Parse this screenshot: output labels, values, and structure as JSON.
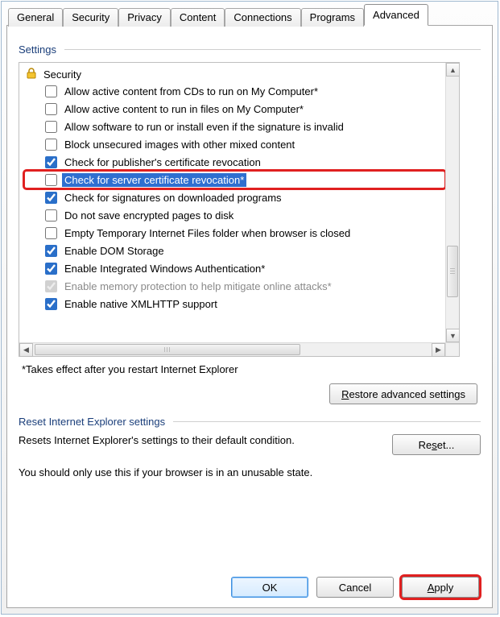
{
  "tabs": [
    "General",
    "Security",
    "Privacy",
    "Content",
    "Connections",
    "Programs",
    "Advanced"
  ],
  "active_tab": "Advanced",
  "settings_group_label": "Settings",
  "category": {
    "icon": "lock-icon",
    "label": "Security"
  },
  "items": [
    {
      "checked": false,
      "label": "Allow active content from CDs to run on My Computer*",
      "selected": false,
      "disabled": false
    },
    {
      "checked": false,
      "label": "Allow active content to run in files on My Computer*",
      "selected": false,
      "disabled": false
    },
    {
      "checked": false,
      "label": "Allow software to run or install even if the signature is invalid",
      "selected": false,
      "disabled": false
    },
    {
      "checked": false,
      "label": "Block unsecured images with other mixed content",
      "selected": false,
      "disabled": false
    },
    {
      "checked": true,
      "label": "Check for publisher's certificate revocation",
      "selected": false,
      "disabled": false
    },
    {
      "checked": false,
      "label": "Check for server certificate revocation*",
      "selected": true,
      "disabled": false,
      "highlight": true
    },
    {
      "checked": true,
      "label": "Check for signatures on downloaded programs",
      "selected": false,
      "disabled": false
    },
    {
      "checked": false,
      "label": "Do not save encrypted pages to disk",
      "selected": false,
      "disabled": false
    },
    {
      "checked": false,
      "label": "Empty Temporary Internet Files folder when browser is closed",
      "selected": false,
      "disabled": false
    },
    {
      "checked": true,
      "label": "Enable DOM Storage",
      "selected": false,
      "disabled": false
    },
    {
      "checked": true,
      "label": "Enable Integrated Windows Authentication*",
      "selected": false,
      "disabled": false
    },
    {
      "checked": true,
      "label": "Enable memory protection to help mitigate online attacks*",
      "selected": false,
      "disabled": true
    },
    {
      "checked": true,
      "label": "Enable native XMLHTTP support",
      "selected": false,
      "disabled": false
    }
  ],
  "restart_note": "*Takes effect after you restart Internet Explorer",
  "restore_button": "Restore advanced settings",
  "reset_group_label": "Reset Internet Explorer settings",
  "reset_desc": "Resets Internet Explorer's settings to their default condition.",
  "reset_button": "Reset...",
  "unusable_note": "You should only use this if your browser is in an unusable state.",
  "footer": {
    "ok": "OK",
    "cancel": "Cancel",
    "apply": "Apply"
  }
}
